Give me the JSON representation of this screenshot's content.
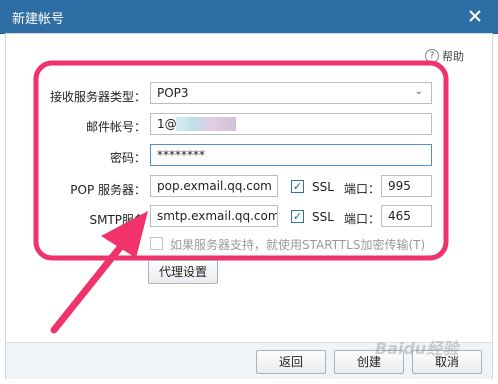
{
  "window": {
    "title": "新建帐号"
  },
  "help": {
    "label": "帮助"
  },
  "form": {
    "server_type_label": "接收服务器类型：",
    "server_type_value": "POP3",
    "account_label": "邮件帐号：",
    "account_value": "1@",
    "password_label": "密码：",
    "password_value": "********",
    "pop_label": "POP 服务器：",
    "pop_value": "pop.exmail.qq.com",
    "pop_ssl_label": "SSL",
    "pop_port_label": "端口：",
    "pop_port_value": "995",
    "smtp_label": "SMTP服务",
    "smtp_value": "smtp.exmail.qq.com",
    "smtp_ssl_label": "SSL",
    "smtp_port_label": "端口：",
    "smtp_port_value": "465",
    "starttls_label": "如果服务器支持，就使用STARTTLS加密传输(T)",
    "pop_ssl_checked": true,
    "smtp_ssl_checked": true,
    "starttls_checked": false
  },
  "proxy_button": "代理设置",
  "footer": {
    "back": "返回",
    "create": "创建",
    "cancel": "取消"
  },
  "watermark": "Baidu经验",
  "annotation": {
    "color": "#f0336a"
  }
}
